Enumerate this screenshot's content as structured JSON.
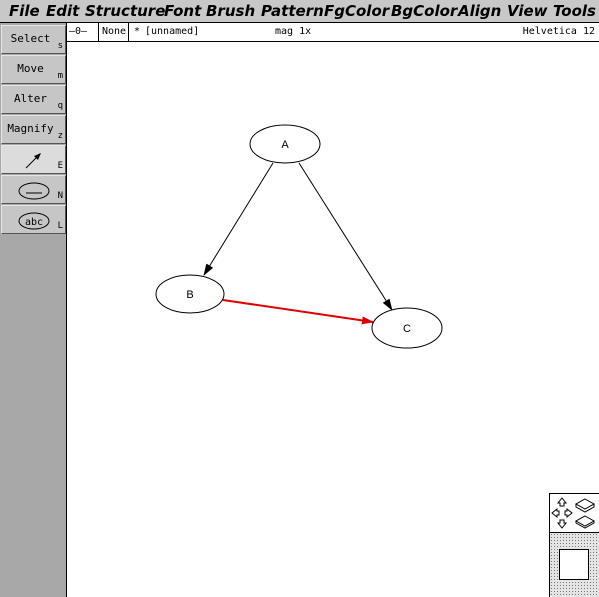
{
  "menubar": {
    "items": [
      "File",
      "Edit",
      "Structure",
      "Font",
      "Brush",
      "Pattern",
      "FgColor",
      "BgColor",
      "Align",
      "View",
      "Tools"
    ]
  },
  "tools": [
    {
      "label": "Select",
      "key": "s",
      "icon": ""
    },
    {
      "label": "Move",
      "key": "m",
      "icon": ""
    },
    {
      "label": "Alter",
      "key": "q",
      "icon": ""
    },
    {
      "label": "Magnify",
      "key": "z",
      "icon": ""
    },
    {
      "label": "",
      "key": "E",
      "icon": "edge-arrow-icon"
    },
    {
      "label": "",
      "key": "N",
      "icon": "node-ellipse-icon"
    },
    {
      "label": "",
      "key": "L",
      "icon": "labeled-node-icon",
      "icon_text": "abc"
    }
  ],
  "infobar": {
    "brush": "—0—",
    "pattern": "None",
    "modified_flag": "*",
    "filename": "[unnamed]",
    "magnification": "mag 1x",
    "font": "Helvetica 12"
  },
  "graph": {
    "nodes": [
      {
        "id": "A",
        "label": "A"
      },
      {
        "id": "B",
        "label": "B"
      },
      {
        "id": "C",
        "label": "C"
      }
    ],
    "edges": [
      {
        "from": "A",
        "to": "B",
        "color": "#000000"
      },
      {
        "from": "A",
        "to": "C",
        "color": "#000000"
      },
      {
        "from": "B",
        "to": "C",
        "color": "#e00000"
      }
    ]
  },
  "panner": {
    "icons": [
      "pan-arrows-icon",
      "zoom-in-icon",
      "zoom-out-icon"
    ]
  }
}
